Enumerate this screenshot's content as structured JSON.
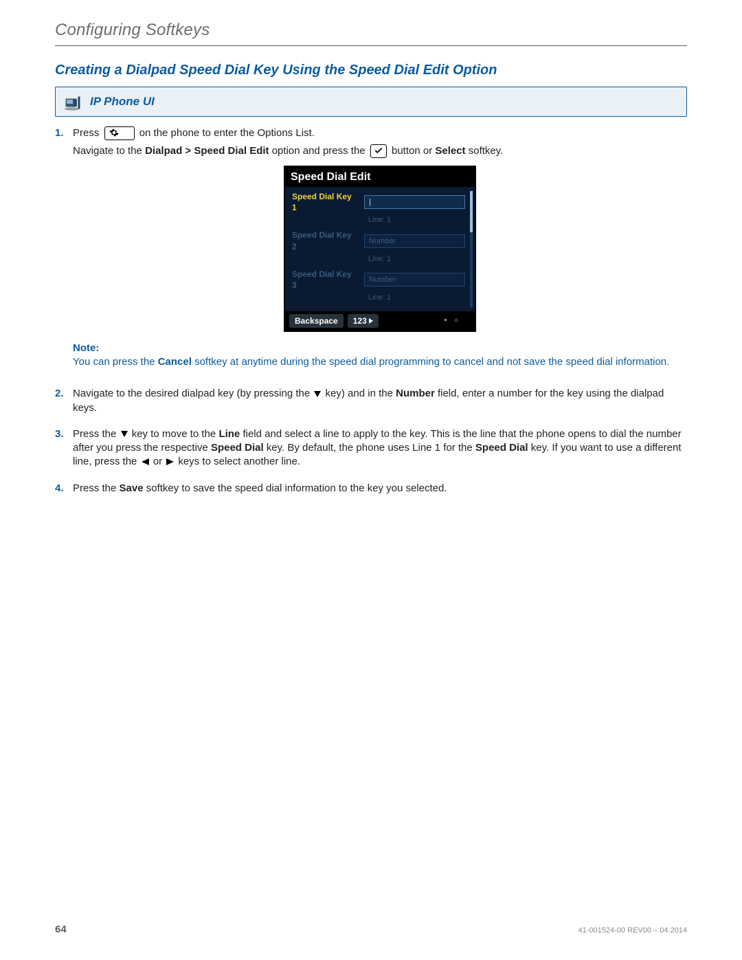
{
  "section_title": "Configuring Softkeys",
  "heading": "Creating a Dialpad Speed Dial Key Using the Speed Dial Edit Option",
  "ui_bar_label": "IP Phone UI",
  "steps": {
    "s1": {
      "num": "1.",
      "a": "Press",
      "b": "on the phone to enter the Options List.",
      "c1": "Navigate to the ",
      "c2": "Dialpad > Speed Dial Edit",
      "c3": " option and press the ",
      "c4": " button or ",
      "c5": "Select",
      "c6": " softkey."
    },
    "s2": {
      "num": "2.",
      "a": "Navigate to the desired dialpad key (by pressing the ",
      "b": " key) and in the ",
      "c": "Number",
      "d": " field, enter a number for the key using the dialpad keys."
    },
    "s3": {
      "num": "3.",
      "a": "Press the ",
      "b": " key to move to the ",
      "c": "Line",
      "d": " field and select a line to apply to the key. This is the line that the phone opens to dial the number after you press the respective ",
      "e": "Speed Dial",
      "f": " key. By default, the phone uses Line 1 for the ",
      "g": "Speed Dial",
      "h": " key. If you want to use a different line, press the ",
      "i": " or ",
      "j": " keys to select another line."
    },
    "s4": {
      "num": "4.",
      "a": "Press the ",
      "b": "Save",
      "c": " softkey to save the speed dial information to the key you selected."
    }
  },
  "note": {
    "label": "Note:",
    "t1": "You can press the ",
    "t2": "Cancel",
    "t3": " softkey at anytime during the speed dial programming to cancel and not save the speed dial information."
  },
  "screen": {
    "title": "Speed Dial Edit",
    "rows": [
      {
        "label": "Speed Dial Key 1",
        "field": "|",
        "sub": "Line: 1",
        "active": true
      },
      {
        "label": "Speed Dial Key 2",
        "field": "Number",
        "sub": "Line: 1",
        "active": false
      },
      {
        "label": "Speed Dial Key 3",
        "field": "Number",
        "sub": "Line: 1",
        "active": false
      }
    ],
    "soft1": "Backspace",
    "soft2": "123",
    "dots": "• ○"
  },
  "footer": {
    "page": "64",
    "docid": "41-001524-00 REV00 – 04.2014"
  }
}
